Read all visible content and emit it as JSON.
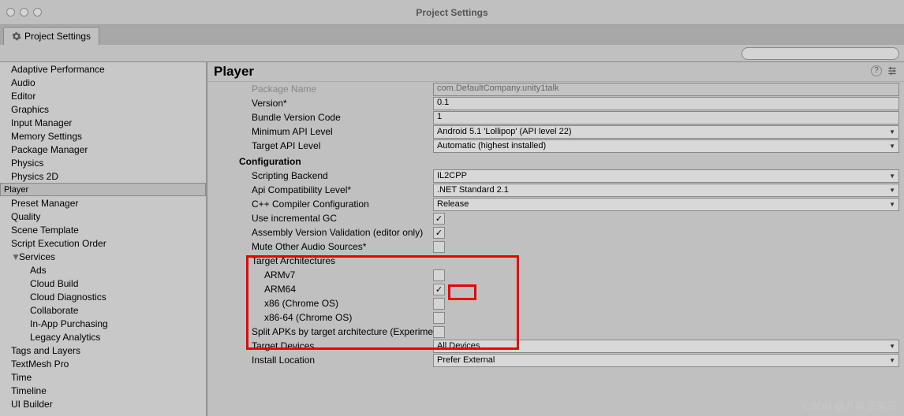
{
  "window": {
    "title": "Project Settings"
  },
  "tab": {
    "label": "Project Settings"
  },
  "search": {
    "placeholder": ""
  },
  "sidebar": {
    "items": [
      {
        "label": "Adaptive Performance"
      },
      {
        "label": "Audio"
      },
      {
        "label": "Editor"
      },
      {
        "label": "Graphics"
      },
      {
        "label": "Input Manager"
      },
      {
        "label": "Memory Settings"
      },
      {
        "label": "Package Manager"
      },
      {
        "label": "Physics"
      },
      {
        "label": "Physics 2D"
      },
      {
        "label": "Player"
      },
      {
        "label": "Preset Manager"
      },
      {
        "label": "Quality"
      },
      {
        "label": "Scene Template"
      },
      {
        "label": "Script Execution Order"
      },
      {
        "label": "Services"
      },
      {
        "label": "Ads"
      },
      {
        "label": "Cloud Build"
      },
      {
        "label": "Cloud Diagnostics"
      },
      {
        "label": "Collaborate"
      },
      {
        "label": "In-App Purchasing"
      },
      {
        "label": "Legacy Analytics"
      },
      {
        "label": "Tags and Layers"
      },
      {
        "label": "TextMesh Pro"
      },
      {
        "label": "Time"
      },
      {
        "label": "Timeline"
      },
      {
        "label": "UI Builder"
      }
    ]
  },
  "main": {
    "title": "Player",
    "pkg_name_label": "Package Name",
    "pkg_name_value": "com.DefaultCompany.unity1talk",
    "version_label": "Version*",
    "version_value": "0.1",
    "bvc_label": "Bundle Version Code",
    "bvc_value": "1",
    "min_api_label": "Minimum API Level",
    "min_api_value": "Android 5.1 'Lollipop' (API level 22)",
    "tgt_api_label": "Target API Level",
    "tgt_api_value": "Automatic (highest installed)",
    "config_label": "Configuration",
    "sb_label": "Scripting Backend",
    "sb_value": "IL2CPP",
    "acl_label": "Api Compatibility Level*",
    "acl_value": ".NET Standard 2.1",
    "ccc_label": "C++ Compiler Configuration",
    "ccc_value": "Release",
    "igc_label": "Use incremental GC",
    "avv_label": "Assembly Version Validation (editor only)",
    "moas_label": "Mute Other Audio Sources*",
    "ta_label": "Target Architectures",
    "armv7_label": "ARMv7",
    "arm64_label": "ARM64",
    "x86_label": "x86 (Chrome OS)",
    "x8664_label": "x86-64 (Chrome OS)",
    "split_label": "Split APKs by target architecture (Experimen",
    "td_label": "Target Devices",
    "td_value": "All Devices",
    "il_label": "Install Location",
    "il_value": "Prefer External"
  },
  "icons": {
    "search": "🔍",
    "help": "?",
    "settings": "⚙"
  },
  "watermark": "CSDN @八哥记笔记"
}
